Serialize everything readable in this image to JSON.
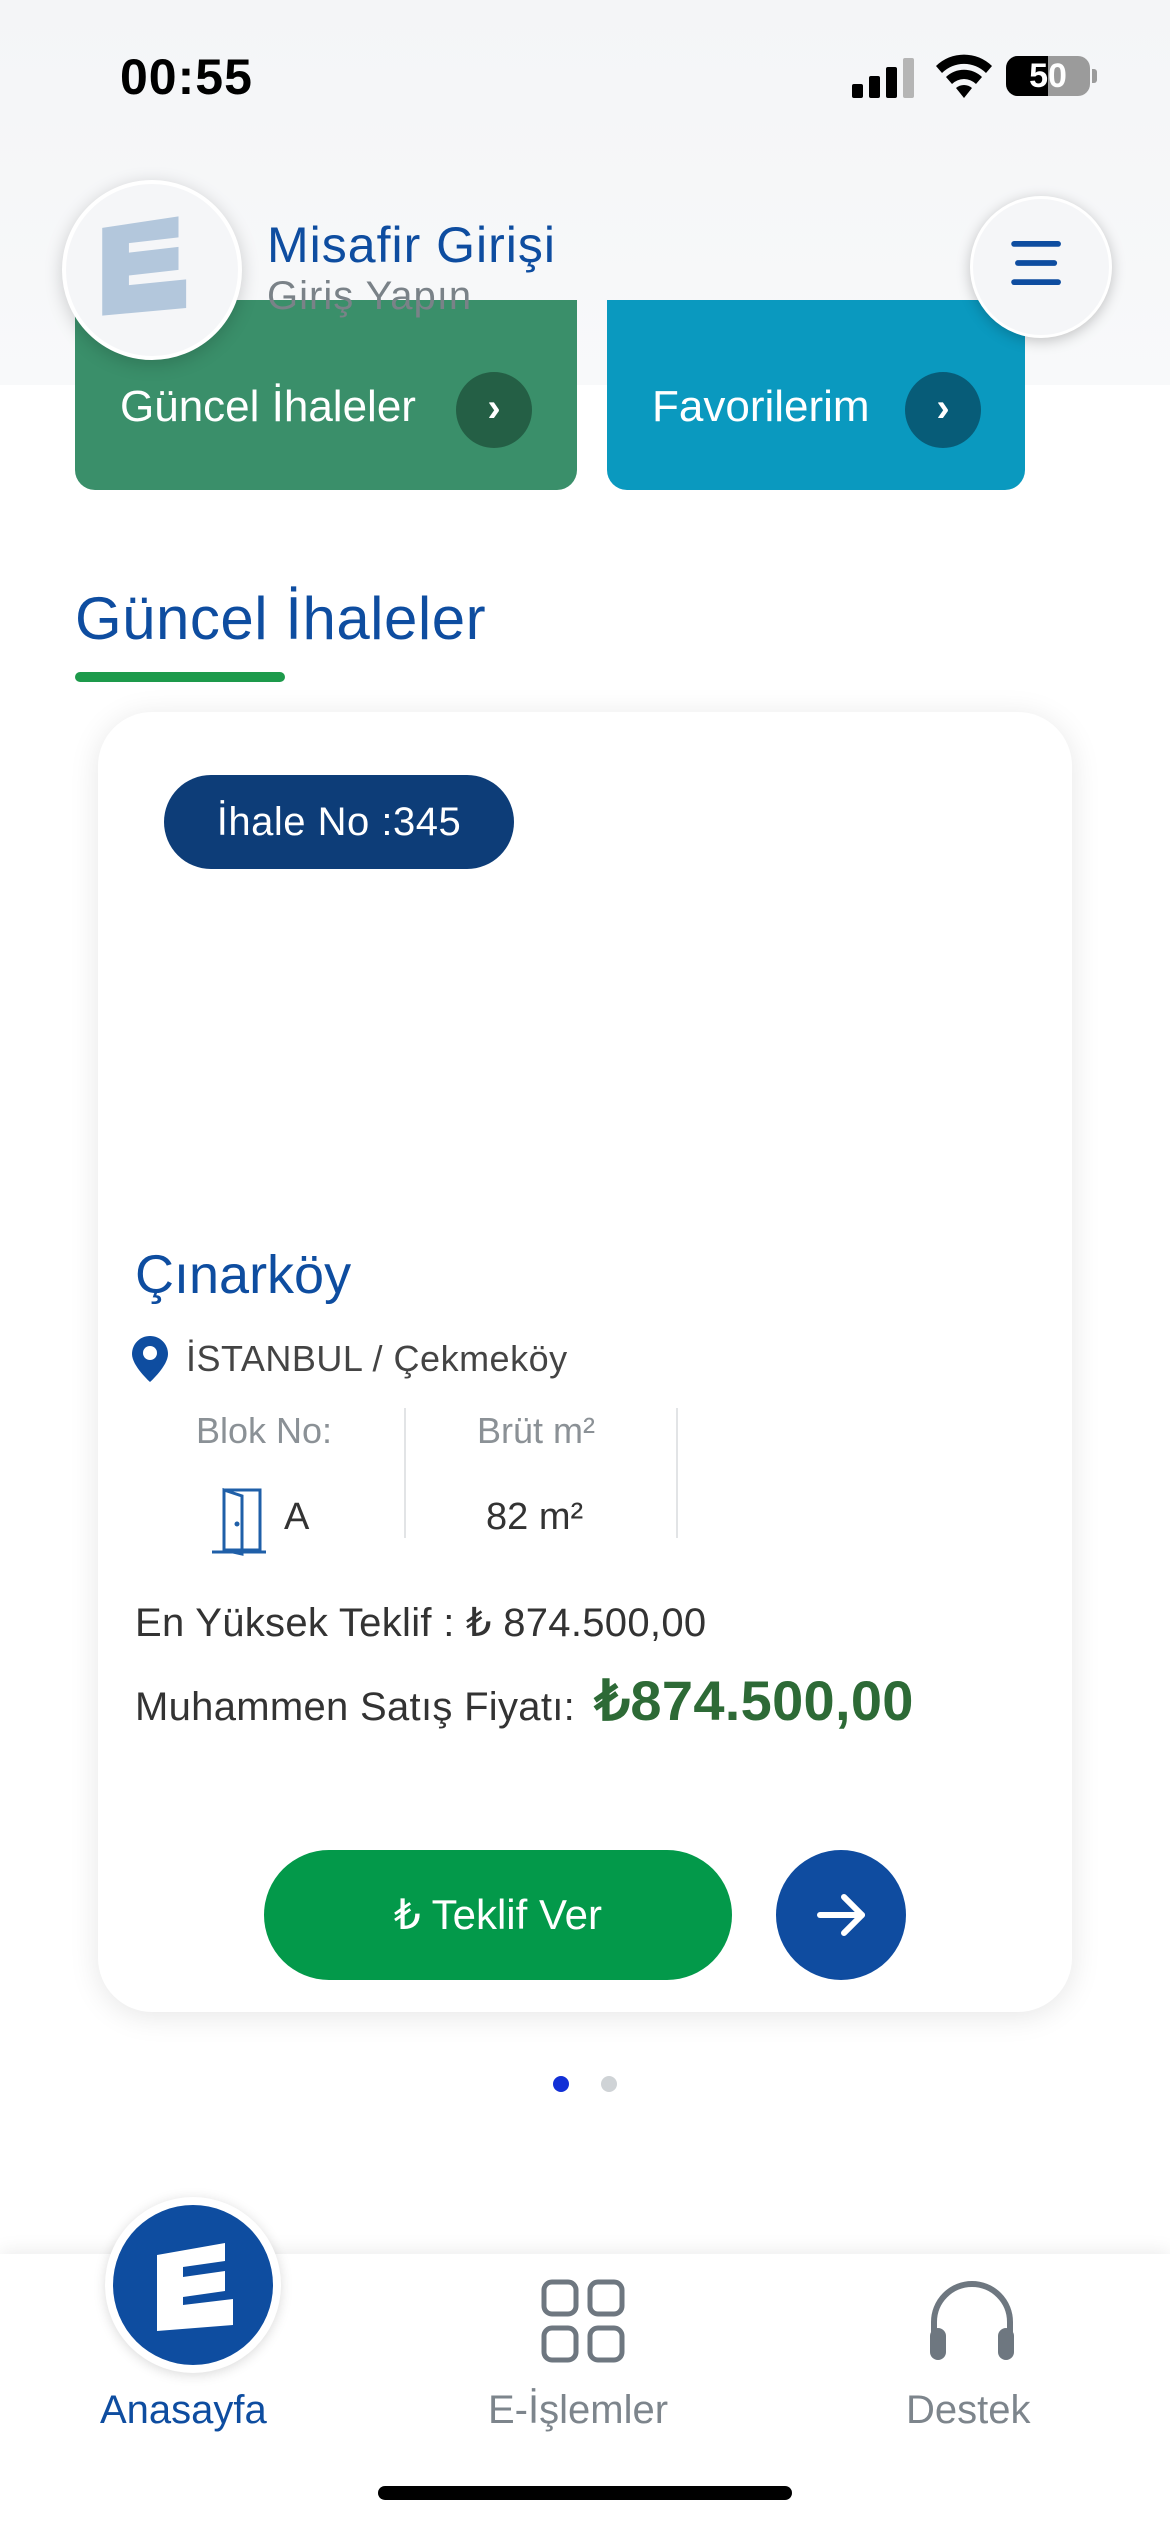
{
  "status_bar": {
    "time": "00:55",
    "battery_percent": "50",
    "battery_level": 0.5
  },
  "header": {
    "title": "Misafir Girişi",
    "subtitle": "Giriş Yapın"
  },
  "quick_links": [
    {
      "label": "Güncel İhaleler",
      "color": "#3a8f6a"
    },
    {
      "label": "Favorilerim",
      "color": "#0a99bf"
    }
  ],
  "section": {
    "title": "Güncel İhaleler"
  },
  "card": {
    "badge": "İhale No :345",
    "title": "Çınarköy",
    "location": "İSTANBUL / Çekmeköy",
    "block_label": "Blok No:",
    "block_value": "A",
    "area_label": "Brüt m²",
    "area_value": "82 m²",
    "highest_offer": "En Yüksek Teklif : ₺ 874.500,00",
    "estimated_label": "Muhammen Satış Fiyatı:",
    "estimated_value": "₺874.500,00",
    "bid_button": "₺ Teklif Ver"
  },
  "pagination": {
    "current": 1,
    "total": 2
  },
  "bottom_nav": [
    {
      "label": "Anasayfa",
      "active": true
    },
    {
      "label": "E-İşlemler",
      "active": false
    },
    {
      "label": "Destek",
      "active": false
    }
  ],
  "colors": {
    "brand_blue": "#0e4da0",
    "accent_green": "#03994a",
    "price_green": "#2d6a36",
    "badge_navy": "#0d3d78"
  }
}
